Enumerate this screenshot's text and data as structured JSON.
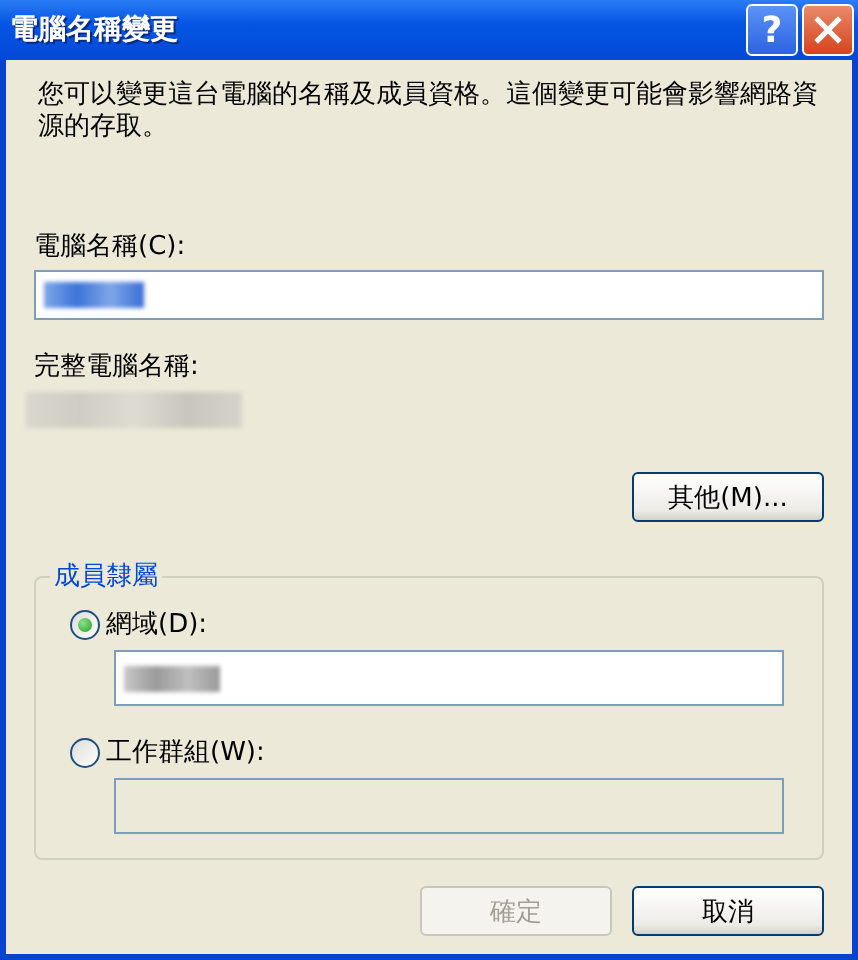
{
  "window": {
    "title": "電腦名稱變更",
    "buttons": [
      {
        "kind": "help",
        "label": "?"
      },
      {
        "kind": "close"
      }
    ]
  },
  "description": "您可以變更這台電腦的名稱及成員資格。這個變更可能會影響網路資源的存取。",
  "computer_name": {
    "label": "電腦名稱(C):",
    "redacted": true,
    "selected": true
  },
  "full_name": {
    "label": "完整電腦名稱:",
    "redacted": true
  },
  "more_button": {
    "label": "其他(M)..."
  },
  "member_of": {
    "title": "成員隸屬",
    "options": [
      {
        "label": "網域(D):",
        "selected": true,
        "redacted": true,
        "disabled": false
      },
      {
        "label": "工作群組(W):",
        "selected": false,
        "redacted": false,
        "disabled": true
      }
    ]
  },
  "buttons": [
    {
      "label": "確定",
      "disabled": true
    },
    {
      "label": "取消",
      "disabled": false
    }
  ]
}
